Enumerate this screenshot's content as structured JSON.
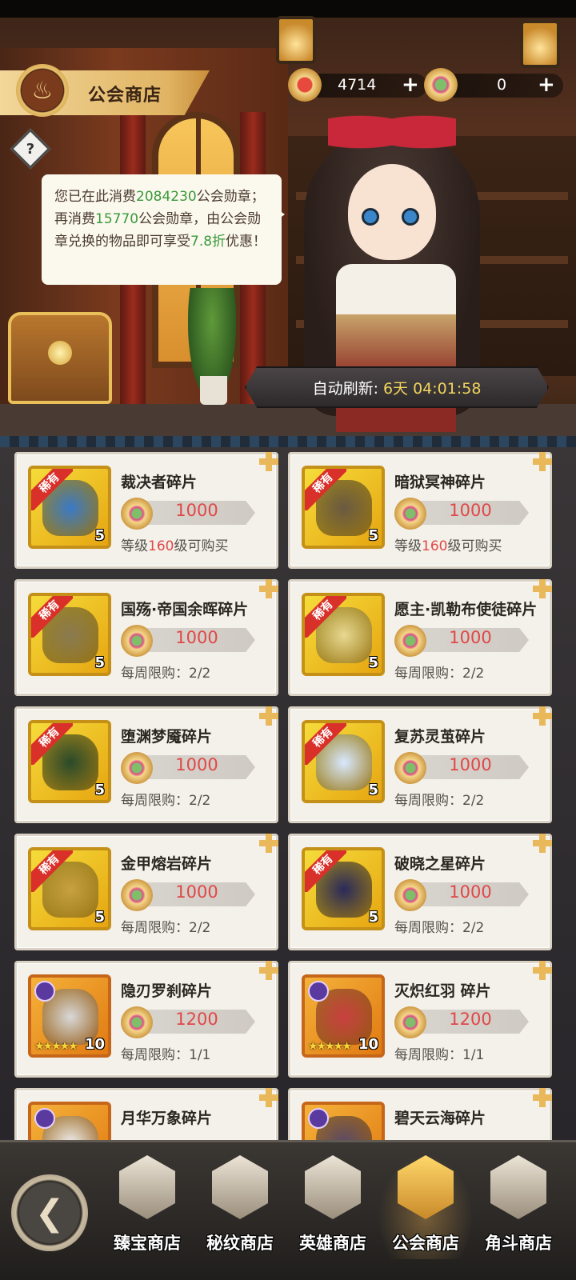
{
  "header": {
    "title": "公会商店",
    "currency_1": {
      "value": "4714",
      "icon": "medal-icon"
    },
    "currency_2": {
      "value": "0",
      "icon": "guild-medal-icon"
    }
  },
  "info": {
    "p1": "您已在此消费",
    "spent": "2084230",
    "p2": "公会勋章；再消费",
    "remaining": "15770",
    "p3": "公会勋章，由公会勋章兑换的物品即可享受",
    "discount": "7.8折",
    "p4": "优惠！"
  },
  "refresh": {
    "label": "自动刷新:",
    "value": "6天 04:01:58"
  },
  "items": [
    {
      "name": "裁决者碎片",
      "price": "1000",
      "qty": "5",
      "rare": "稀有",
      "cond_pre": "等级",
      "cond_num": "160",
      "cond_post": "级可购买"
    },
    {
      "name": "暗狱冥神碎片",
      "price": "1000",
      "qty": "5",
      "rare": "稀有",
      "cond_pre": "等级",
      "cond_num": "160",
      "cond_post": "级可购买"
    },
    {
      "name": "国殇·帝国余晖碎片",
      "price": "1000",
      "qty": "5",
      "rare": "稀有",
      "cond_pre": "每周限购：2/2",
      "cond_num": "",
      "cond_post": ""
    },
    {
      "name": "愿主·凯勒布使徒碎片",
      "price": "1000",
      "qty": "5",
      "rare": "稀有",
      "cond_pre": "每周限购：2/2",
      "cond_num": "",
      "cond_post": ""
    },
    {
      "name": "堕渊梦魇碎片",
      "price": "1000",
      "qty": "5",
      "rare": "稀有",
      "cond_pre": "每周限购：2/2",
      "cond_num": "",
      "cond_post": ""
    },
    {
      "name": "复苏灵茧碎片",
      "price": "1000",
      "qty": "5",
      "rare": "稀有",
      "cond_pre": "每周限购：2/2",
      "cond_num": "",
      "cond_post": ""
    },
    {
      "name": "金甲熔岩碎片",
      "price": "1000",
      "qty": "5",
      "rare": "稀有",
      "cond_pre": "每周限购：2/2",
      "cond_num": "",
      "cond_post": ""
    },
    {
      "name": "破晓之星碎片",
      "price": "1000",
      "qty": "5",
      "rare": "稀有",
      "cond_pre": "每周限购：2/2",
      "cond_num": "",
      "cond_post": ""
    },
    {
      "name": "隐刃罗刹碎片",
      "price": "1200",
      "qty": "10",
      "rare": "",
      "cond_pre": "每周限购：1/1",
      "cond_num": "",
      "cond_post": ""
    },
    {
      "name": "灭炽红羽 碎片",
      "price": "1200",
      "qty": "10",
      "rare": "",
      "cond_pre": "每周限购：1/1",
      "cond_num": "",
      "cond_post": ""
    },
    {
      "name": "月华万象碎片",
      "price": "",
      "qty": "",
      "rare": "",
      "cond_pre": "",
      "cond_num": "",
      "cond_post": ""
    },
    {
      "name": "碧天云海碎片",
      "price": "",
      "qty": "",
      "rare": "",
      "cond_pre": "",
      "cond_num": "",
      "cond_post": ""
    }
  ],
  "nav": {
    "items": [
      {
        "label": "臻宝商店"
      },
      {
        "label": "秘纹商店"
      },
      {
        "label": "英雄商店"
      },
      {
        "label": "公会商店"
      },
      {
        "label": "角斗商店"
      }
    ]
  }
}
